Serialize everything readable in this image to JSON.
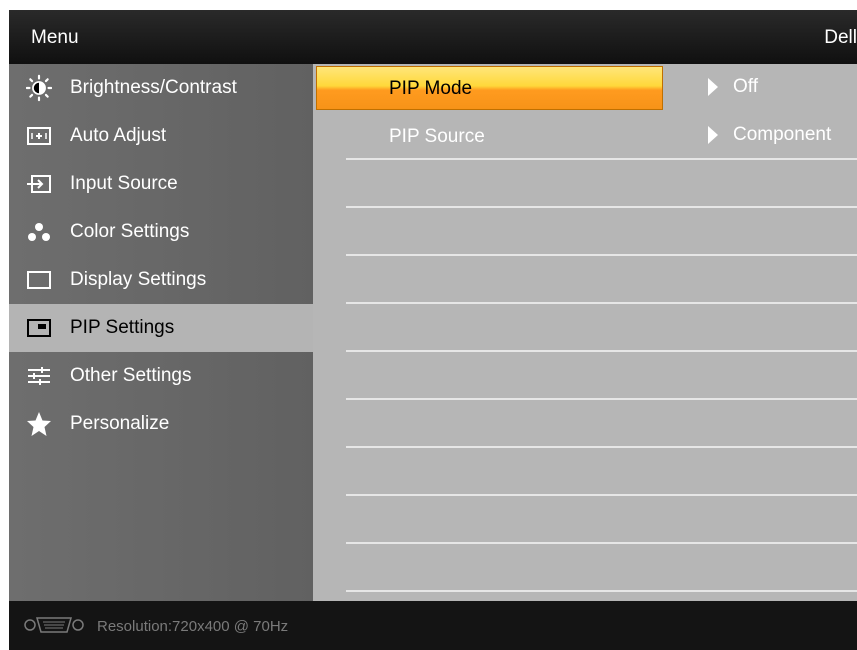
{
  "header": {
    "title": "Menu",
    "brand": "Dell"
  },
  "sidebar": {
    "items": [
      {
        "label": "Brightness/Contrast",
        "icon": "brightness-icon"
      },
      {
        "label": "Auto Adjust",
        "icon": "auto-adjust-icon"
      },
      {
        "label": "Input Source",
        "icon": "input-source-icon"
      },
      {
        "label": "Color Settings",
        "icon": "color-settings-icon"
      },
      {
        "label": "Display Settings",
        "icon": "display-settings-icon"
      },
      {
        "label": "PIP Settings",
        "icon": "pip-icon",
        "active": true
      },
      {
        "label": "Other Settings",
        "icon": "sliders-icon"
      },
      {
        "label": "Personalize",
        "icon": "star-icon"
      }
    ]
  },
  "pip": {
    "rows": [
      {
        "label": "PIP Mode",
        "value": "Off",
        "selected": true
      },
      {
        "label": "PIP Source",
        "value": "Component"
      }
    ]
  },
  "footer": {
    "resolution": "Resolution:720x400 @ 70Hz",
    "icon": "vga-connector-icon"
  },
  "colors": {
    "header_bg": "#141414",
    "sidebar_bg": "#6a6a6a",
    "active_item_bg": "#b4b4b4",
    "content_bg": "#b6b6b6",
    "highlight_top": "#ffe67a",
    "highlight_bottom": "#f79318"
  }
}
